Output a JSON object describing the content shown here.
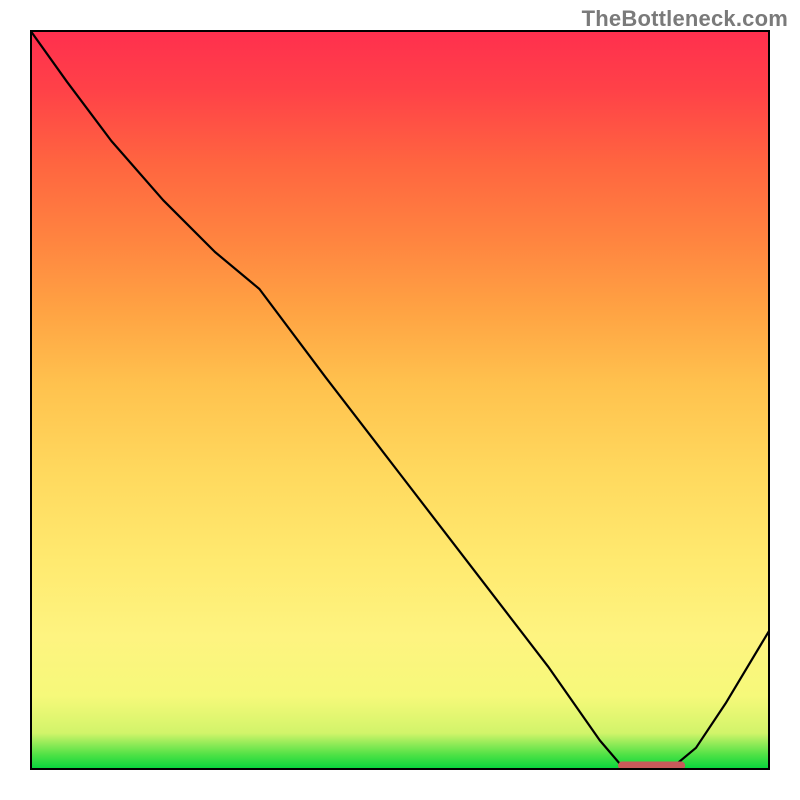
{
  "watermark": {
    "text": "TheBottleneck.com"
  },
  "chart_data": {
    "type": "line",
    "title": "",
    "xlabel": "",
    "ylabel": "",
    "xlim": [
      0,
      100
    ],
    "ylim": [
      0,
      100
    ],
    "annotations": [],
    "series": [
      {
        "name": "curve",
        "x": [
          0,
          5,
          11,
          18,
          25,
          31,
          40,
          50,
          60,
          70,
          77,
          80,
          82,
          85,
          87,
          90,
          94,
          100
        ],
        "values": [
          100,
          93,
          85,
          77,
          70,
          65,
          53,
          40,
          27,
          14,
          4,
          0.5,
          0,
          0,
          0.5,
          3,
          9,
          19
        ]
      },
      {
        "name": "optimal-marker",
        "x": [
          80,
          88
        ],
        "values": [
          0.6,
          0.6
        ]
      }
    ],
    "colors": {
      "curve": "#000000",
      "optimal-marker": "#c85a5a"
    }
  }
}
